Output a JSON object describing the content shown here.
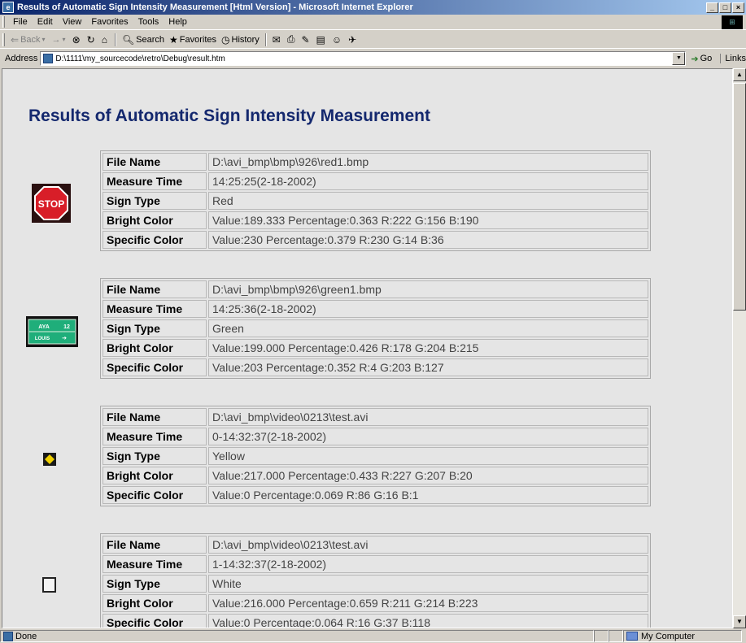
{
  "window": {
    "title": "Results of Automatic Sign Intensity Measurement [Html Version] - Microsoft Internet Explorer",
    "buttons": [
      "_",
      "□",
      "×"
    ]
  },
  "menu": [
    "File",
    "Edit",
    "View",
    "Favorites",
    "Tools",
    "Help"
  ],
  "toolbar": {
    "back": "Back",
    "forward": "→",
    "stop": "⊗",
    "refresh": "↻",
    "home": "⌂",
    "search": "Search",
    "favorites": "Favorites",
    "history": "History"
  },
  "address": {
    "label": "Address",
    "url": "D:\\1111\\my_sourcecode\\retro\\Debug\\result.htm",
    "go": "Go",
    "links": "Links"
  },
  "page": {
    "heading": "Results of Automatic Sign Intensity Measurement"
  },
  "records": [
    {
      "sign": "stop-sign",
      "rows": [
        {
          "key": "File Name",
          "value": "D:\\avi_bmp\\bmp\\926\\red1.bmp"
        },
        {
          "key": "Measure Time",
          "value": "14:25:25(2-18-2002)"
        },
        {
          "key": "Sign Type",
          "value": "Red"
        },
        {
          "key": "Bright Color",
          "value": "Value:189.333 Percentage:0.363 R:222 G:156 B:190"
        },
        {
          "key": "Specific Color",
          "value": "Value:230 Percentage:0.379 R:230 G:14 B:36"
        }
      ]
    },
    {
      "sign": "green-guide-sign",
      "rows": [
        {
          "key": "File Name",
          "value": "D:\\avi_bmp\\bmp\\926\\green1.bmp"
        },
        {
          "key": "Measure Time",
          "value": "14:25:36(2-18-2002)"
        },
        {
          "key": "Sign Type",
          "value": "Green"
        },
        {
          "key": "Bright Color",
          "value": "Value:199.000 Percentage:0.426 R:178 G:204 B:215"
        },
        {
          "key": "Specific Color",
          "value": "Value:203 Percentage:0.352 R:4 G:203 B:127"
        }
      ]
    },
    {
      "sign": "yellow-diamond-sign",
      "rows": [
        {
          "key": "File Name",
          "value": "D:\\avi_bmp\\video\\0213\\test.avi"
        },
        {
          "key": "Measure Time",
          "value": "0-14:32:37(2-18-2002)"
        },
        {
          "key": "Sign Type",
          "value": "Yellow"
        },
        {
          "key": "Bright Color",
          "value": "Value:217.000 Percentage:0.433 R:227 G:207 B:20"
        },
        {
          "key": "Specific Color",
          "value": "Value:0 Percentage:0.069 R:86 G:16 B:1"
        }
      ]
    },
    {
      "sign": "white-sign",
      "rows": [
        {
          "key": "File Name",
          "value": "D:\\avi_bmp\\video\\0213\\test.avi"
        },
        {
          "key": "Measure Time",
          "value": "1-14:32:37(2-18-2002)"
        },
        {
          "key": "Sign Type",
          "value": "White"
        },
        {
          "key": "Bright Color",
          "value": "Value:216.000 Percentage:0.659 R:211 G:214 B:223"
        },
        {
          "key": "Specific Color",
          "value": "Value:0 Percentage:0.064 R:16 G:37 B:118"
        }
      ]
    }
  ],
  "stop_text": "STOP",
  "green_sign_text": [
    "AYA",
    "12",
    "LOUIS"
  ],
  "status": {
    "left": "Done",
    "zone": "My Computer"
  },
  "colors": {
    "heading": "#14286e",
    "stop_red": "#d81e28",
    "guide_green": "#1fae7a",
    "yellow": "#f0d000"
  }
}
